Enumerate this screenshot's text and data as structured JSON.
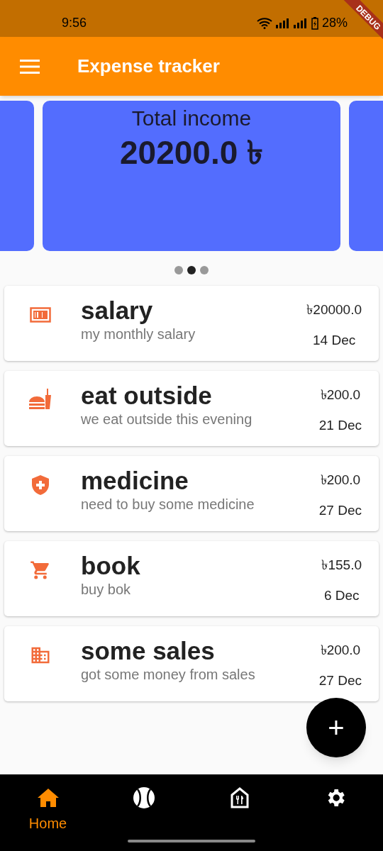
{
  "status_bar": {
    "time": "9:56",
    "battery": "28%"
  },
  "debug_banner": "DEBUG",
  "app_bar": {
    "title": "Expense tracker"
  },
  "carousel": {
    "card": {
      "title": "Total income",
      "amount": "20200.0 ৳"
    },
    "dots": [
      {
        "selected": false
      },
      {
        "selected": true
      },
      {
        "selected": false
      }
    ]
  },
  "transactions": [
    {
      "kind": "money",
      "title": "salary",
      "note": "my monthly salary",
      "amount": "৳20000.0",
      "date": "14 Dec"
    },
    {
      "kind": "food",
      "title": "eat outside",
      "note": "we eat outside this evening",
      "amount": "৳200.0",
      "date": "21 Dec"
    },
    {
      "kind": "medical",
      "title": "medicine",
      "note": "need to buy some medicine",
      "amount": "৳200.0",
      "date": "27 Dec"
    },
    {
      "kind": "cart",
      "title": "book",
      "note": "buy bok",
      "amount": "৳155.0",
      "date": "6 Dec"
    },
    {
      "kind": "building",
      "title": "some sales",
      "note": "got some money from sales",
      "amount": "৳200.0",
      "date": "27 Dec"
    }
  ],
  "fab": "+",
  "bottom_nav": [
    {
      "kind": "home",
      "label": "Home",
      "selected": true
    },
    {
      "kind": "ball",
      "selected": false
    },
    {
      "kind": "restaurant",
      "selected": false
    },
    {
      "kind": "settings",
      "selected": false
    }
  ]
}
